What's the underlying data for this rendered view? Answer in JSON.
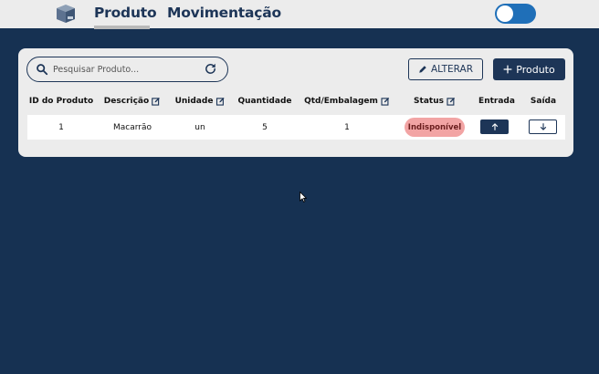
{
  "topbar": {
    "logo_icon": "box-icon",
    "tabs": [
      {
        "label": "Produto",
        "active": true
      },
      {
        "label": "Movimentação",
        "active": false
      }
    ],
    "toggle": {
      "on": true,
      "color": "#1f6fb8"
    }
  },
  "toolbar": {
    "search_placeholder": "Pesquisar Produto...",
    "search_value": "",
    "alterar_label": "ALTERAR",
    "produto_label": "Produto"
  },
  "table": {
    "headers": [
      "ID do Produto",
      "Descrição",
      "Unidade",
      "Quantidade",
      "Qtd/Embalagem",
      "Status",
      "Entrada",
      "Saída"
    ],
    "rows": [
      {
        "id": "1",
        "descricao": "Macarrão",
        "unidade": "un",
        "quantidade": "5",
        "qtd_embalagem": "1",
        "status": "Indisponível"
      }
    ]
  },
  "colors": {
    "background": "#163152",
    "primary": "#1d3557",
    "status_unavailable": "#f2a4a4",
    "topbar": "#ececec"
  }
}
